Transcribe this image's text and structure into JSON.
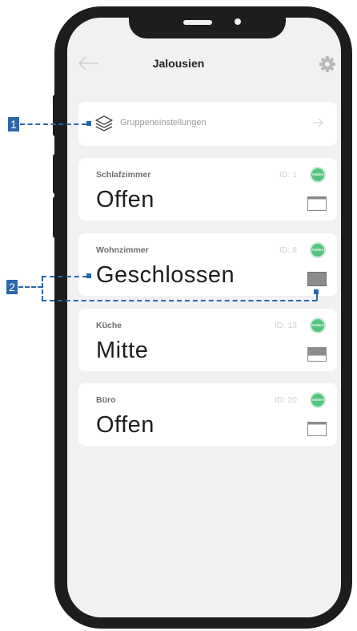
{
  "header": {
    "title": "Jalousien",
    "back_icon": "arrow-left-icon",
    "settings_icon": "gear-icon"
  },
  "group_settings": {
    "label": "Gruppeneinstellungen",
    "icon": "layers-icon",
    "arrow_icon": "arrow-right-icon"
  },
  "rooms": [
    {
      "name": "Schlafzimmer",
      "id": "ID: 1",
      "status": "Offen",
      "online": "Online",
      "blind": "open"
    },
    {
      "name": "Wohnzimmer",
      "id": "ID: 8",
      "status": "Geschlossen",
      "online": "Online",
      "blind": "closed"
    },
    {
      "name": "Küche",
      "id": "ID: 13",
      "status": "Mitte",
      "online": "Online",
      "blind": "half"
    },
    {
      "name": "Büro",
      "id": "ID: 20",
      "status": "Offen",
      "online": "Online",
      "blind": "open"
    }
  ],
  "annotations": {
    "marker_1": "1",
    "marker_2": "2"
  },
  "colors": {
    "accent": "#2c66ac",
    "online": "#53c47d",
    "background": "#f1f1f3",
    "frame": "#1d1d1d"
  }
}
